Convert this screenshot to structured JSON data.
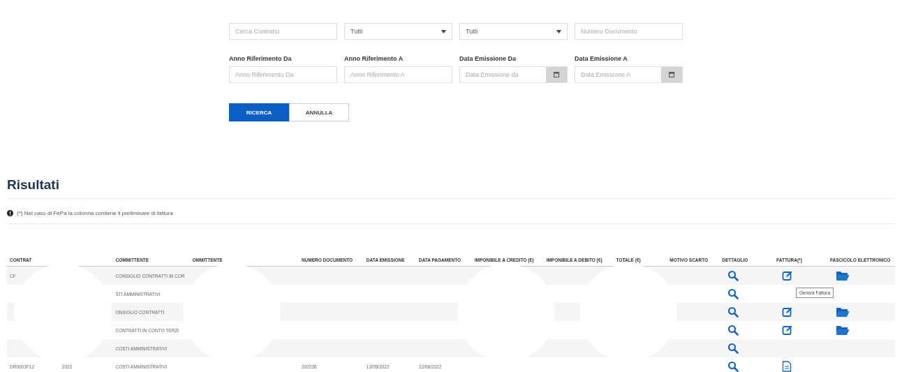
{
  "filters": {
    "rows": [
      [
        {
          "kind": "text",
          "placeholder": "Cerca Contratto"
        },
        {
          "kind": "select",
          "value": "Tutti"
        },
        {
          "kind": "select",
          "value": "Tutti"
        },
        {
          "kind": "text",
          "placeholder": "Numero Documento"
        }
      ],
      [
        {
          "kind": "text",
          "label": "Anno Riferimento Da",
          "placeholder": "Anno Riferimento Da"
        },
        {
          "kind": "text",
          "label": "Anno Riferimento A",
          "placeholder": "Anno Riferimento A"
        },
        {
          "kind": "date",
          "label": "Data Emissione Da",
          "placeholder": "Data Emissione da"
        },
        {
          "kind": "date",
          "label": "Data Emissione A",
          "placeholder": "Data Emissione A"
        }
      ]
    ],
    "buttons": [
      {
        "label": "RICERCA",
        "primary": true
      },
      {
        "label": "ANNULLA",
        "primary": false
      }
    ]
  },
  "results": {
    "title": "Risultati",
    "note": "(*) Nel caso di FePa la colonna contiene il preliminare di fattura",
    "table": {
      "columns": [
        {
          "label": "CONTRAT"
        },
        {},
        {
          "label": "COMMITTENTE"
        },
        {
          "label": "OMMITTENTE"
        },
        {
          "label": "NUMERO DOCUMENTO"
        },
        {
          "label": "DATA EMISSIONE"
        },
        {
          "label": "DATA PAGAMENTO"
        },
        {
          "label": "IMPONIBILE A CREDITO (€)"
        },
        {
          "label": "IMPONIBILE A DEBITO (€)"
        },
        {
          "label": "TOTALE (€)"
        },
        {
          "label": "MOTIVO SCARTO"
        },
        {
          "label": "DETTAGLIO"
        },
        {
          "label": "FATTURA(*)"
        },
        {
          "label": "FASCICOLO ELETTRONICO"
        }
      ],
      "rows": [
        {
          "cells": [
            "CF",
            null,
            "CONSIGLIO CONTRATTI IN COR",
            null,
            null,
            null,
            null,
            null,
            null,
            null,
            null
          ],
          "invoice": {
            "kind": "edit"
          },
          "folder": true
        },
        {
          "cells": [
            null,
            null,
            "STI AMMINISTRATIVI",
            null,
            null,
            null,
            null,
            null,
            null,
            null,
            null
          ],
          "folder": false
        },
        {
          "cells": [
            null,
            null,
            "ONSIGLIO CONTRATTI",
            null,
            null,
            null,
            null,
            null,
            null,
            null,
            null
          ],
          "invoice": {
            "kind": "edit"
          },
          "folder": true
        },
        {
          "cells": [
            null,
            null,
            "CONTRATTI IN CONTO TERZI",
            null,
            null,
            null,
            null,
            null,
            null,
            null,
            null
          ],
          "invoice": {
            "kind": "edit"
          },
          "folder": true
        },
        {
          "cells": [
            null,
            null,
            "COSTI AMMINISTRATIVI",
            null,
            null,
            null,
            null,
            null,
            null,
            null,
            null
          ],
          "folder": false
        },
        {
          "cells": [
            "DR0001F12",
            "2022",
            "COSTI AMMINISTRATIVI",
            null,
            "202236",
            "13/05/2022",
            "22/06/2022",
            null,
            null,
            null,
            null
          ],
          "invoice": {
            "kind": "document"
          },
          "folder": false
        }
      ]
    },
    "tooltip": {
      "text": "Genera Fattura"
    }
  }
}
